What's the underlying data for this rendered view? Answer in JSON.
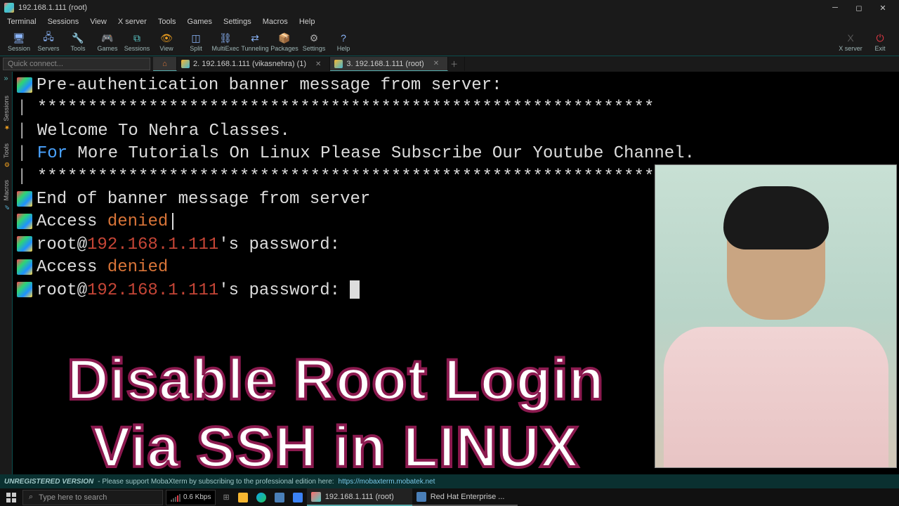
{
  "window": {
    "title": "192.168.1.111 (root)"
  },
  "menu": [
    "Terminal",
    "Sessions",
    "View",
    "X server",
    "Tools",
    "Games",
    "Settings",
    "Macros",
    "Help"
  ],
  "toolbar": [
    {
      "id": "session",
      "label": "Session",
      "icon": "🖥",
      "color": "#8ab4f8"
    },
    {
      "id": "servers",
      "label": "Servers",
      "icon": "🖧",
      "color": "#8ab4f8"
    },
    {
      "id": "tools",
      "label": "Tools",
      "icon": "🔧",
      "color": "#f0a020"
    },
    {
      "id": "games",
      "label": "Games",
      "icon": "🎮",
      "color": "#f7b731"
    },
    {
      "id": "sessions",
      "label": "Sessions",
      "icon": "⧉",
      "color": "#5ac8c8"
    },
    {
      "id": "view",
      "label": "View",
      "icon": "👁",
      "color": "#f0a020"
    },
    {
      "id": "split",
      "label": "Split",
      "icon": "◫",
      "color": "#8ab4f8"
    },
    {
      "id": "multiexec",
      "label": "MultiExec",
      "icon": "⛓",
      "color": "#8ab4f8"
    },
    {
      "id": "tunneling",
      "label": "Tunneling",
      "icon": "⇄",
      "color": "#8ab4f8"
    },
    {
      "id": "packages",
      "label": "Packages",
      "icon": "📦",
      "color": "#f7b731"
    },
    {
      "id": "settings",
      "label": "Settings",
      "icon": "⚙",
      "color": "#aaa"
    },
    {
      "id": "help",
      "label": "Help",
      "icon": "?",
      "color": "#8ab4f8"
    }
  ],
  "toolbar_right": [
    {
      "id": "xserver",
      "label": "X server",
      "icon": "X",
      "color": "#555"
    },
    {
      "id": "exit",
      "label": "Exit",
      "icon": "⏻",
      "color": "#e63946"
    }
  ],
  "quick_connect": "Quick connect...",
  "tabs": [
    {
      "id": "home",
      "label": "",
      "home": true
    },
    {
      "id": "t1",
      "label": "2. 192.168.1.111 (vikasnehra) (1)"
    },
    {
      "id": "t2",
      "label": "3. 192.168.1.111 (root)",
      "active": true
    }
  ],
  "side": [
    "Sessions",
    "Tools",
    "Macros"
  ],
  "terminal": {
    "l1_pre": "Pre-authentication banner message from server:",
    "stars": "*************************************************************",
    "welcome": "Welcome To Nehra Classes.",
    "for": "For",
    "more": " More Tutorials On Linux Please Subscribe Our Youtube Channel.",
    "end": "End of banner message from server",
    "access": "Access ",
    "denied": "denied",
    "rootat": "root@",
    "ip": "192.168.1.111",
    "pwd": "'s password: "
  },
  "overlay": {
    "line1": "Disable Root Login",
    "line2": "Via SSH in LINUX"
  },
  "status": {
    "unreg": "UNREGISTERED VERSION",
    "msg": " -  Please support MobaXterm by subscribing to the professional edition here: ",
    "link": "https://mobaxterm.mobatek.net"
  },
  "taskbar": {
    "search": "Type here to search",
    "net": "0.6 Kbps",
    "app1": "192.168.1.111 (root)",
    "app2": "Red Hat Enterprise ..."
  }
}
